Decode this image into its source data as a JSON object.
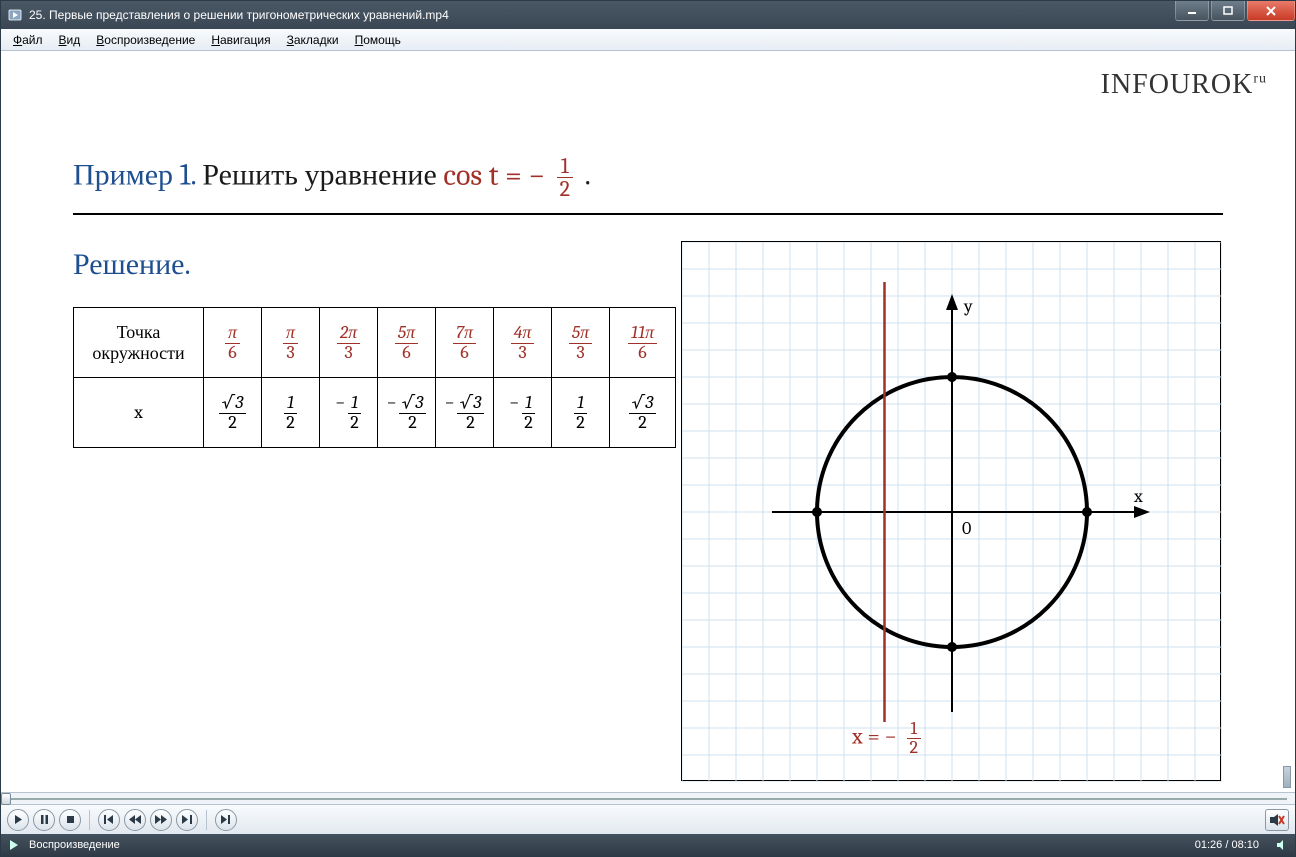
{
  "window": {
    "title": "25. Первые представления о решении тригонометрических уравнений.mp4",
    "controls": {
      "min": "_",
      "max": "▭",
      "close": "X"
    }
  },
  "menu": {
    "items": [
      "Файл",
      "Вид",
      "Воспроизведение",
      "Навигация",
      "Закладки",
      "Помощь"
    ]
  },
  "logo": {
    "text": "INFOUROK",
    "sup": "ru"
  },
  "example": {
    "prefix": "Пример 1.",
    "text": " Решить уравнение ",
    "eq_lhs": "cos t = − ",
    "frac_n": "1",
    "frac_d": "2",
    "tail": " ."
  },
  "solution_label": "Решение.",
  "table": {
    "row1_label": "Точка\nокружности",
    "row2_label": "x",
    "angles": [
      {
        "n": "π",
        "d": "6"
      },
      {
        "n": "π",
        "d": "3"
      },
      {
        "n": "2π",
        "d": "3"
      },
      {
        "n": "5π",
        "d": "6"
      },
      {
        "n": "7π",
        "d": "6"
      },
      {
        "n": "4π",
        "d": "3"
      },
      {
        "n": "5π",
        "d": "3"
      },
      {
        "n": "11π",
        "d": "6"
      }
    ],
    "xvals": [
      {
        "neg": false,
        "n": "√3",
        "d": "2"
      },
      {
        "neg": false,
        "n": "1",
        "d": "2"
      },
      {
        "neg": true,
        "n": "1",
        "d": "2"
      },
      {
        "neg": true,
        "n": "√3",
        "d": "2"
      },
      {
        "neg": true,
        "n": "√3",
        "d": "2"
      },
      {
        "neg": true,
        "n": "1",
        "d": "2"
      },
      {
        "neg": false,
        "n": "1",
        "d": "2"
      },
      {
        "neg": false,
        "n": "√3",
        "d": "2"
      }
    ]
  },
  "graph": {
    "x_label": "x",
    "y_label": "y",
    "origin_label": "0",
    "caption_prefix": "x = − ",
    "caption_frac_n": "1",
    "caption_frac_d": "2"
  },
  "chart_data": {
    "type": "line",
    "title": "Unit circle with vertical line x = -1/2",
    "xlabel": "x",
    "ylabel": "y",
    "xlim": [
      -1.35,
      1.35
    ],
    "ylim": [
      -1.35,
      1.35
    ],
    "series": [
      {
        "name": "unit_circle",
        "equation": "x^2 + y^2 = 1"
      },
      {
        "name": "vertical_line",
        "x": -0.5
      }
    ],
    "points": [
      {
        "x": 1,
        "y": 0
      },
      {
        "x": -1,
        "y": 0
      },
      {
        "x": 0,
        "y": 1
      },
      {
        "x": 0,
        "y": -1
      }
    ]
  },
  "playback": {
    "position_pct": 17.8,
    "current": "01:26",
    "total": "08:10",
    "status_text": "Воспроизведение"
  }
}
